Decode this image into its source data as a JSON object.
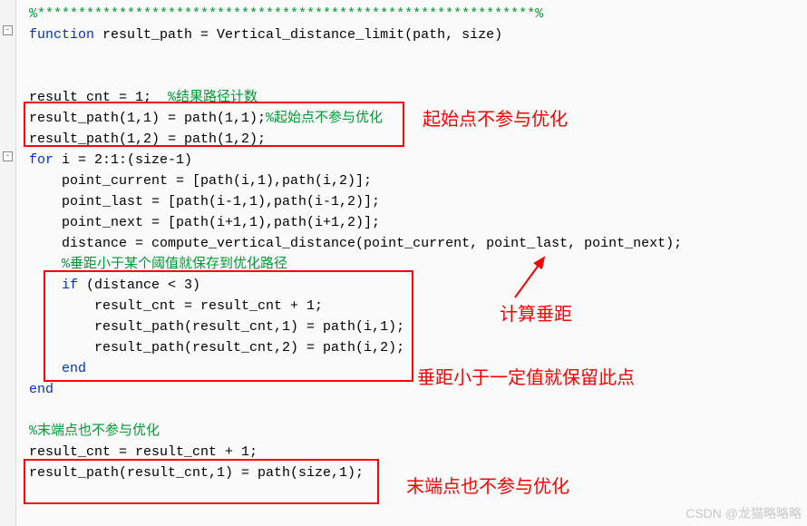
{
  "lines": {
    "l0": "%*************************************************************%",
    "l1_a": "function",
    "l1_b": " result_path = Vertical_distance_limit(path, size)",
    "l2": "",
    "l3": "",
    "l4_a": "result_cnt = 1;  ",
    "l4_b": "%结果路径计数",
    "l5_a": "result_path(1,1) = path(1,1);",
    "l5_b": "%起始点不参与优化",
    "l6": "result_path(1,2) = path(1,2);",
    "l7_a": "for",
    "l7_b": " i = 2:1:(size-1)",
    "l8": "    point_current = [path(i,1),path(i,2)];",
    "l9": "    point_last = [path(i-1,1),path(i-1,2)];",
    "l10": "    point_next = [path(i+1,1),path(i+1,2)];",
    "l11": "    distance = compute_vertical_distance(point_current, point_last, point_next);",
    "l12": "%垂距小于某个阈值就保存到优化路径",
    "l13_a": "    if",
    "l13_b": " (distance < 3)",
    "l14": "        result_cnt = result_cnt + 1;",
    "l15": "        result_path(result_cnt,1) = path(i,1);",
    "l16": "        result_path(result_cnt,2) = path(i,2);",
    "l17": "    end",
    "l18": "end",
    "l19": "",
    "l20": "%末端点也不参与优化",
    "l21": "result_cnt = result_cnt + 1;",
    "l22": "result_path(result_cnt,1) = path(size,1);"
  },
  "annotations": {
    "a1": "起始点不参与优化",
    "a2": "计算垂距",
    "a3": "垂距小于一定值就保留此点",
    "a4": "末端点也不参与优化"
  },
  "watermark": "CSDN @龙猫略略略",
  "fold": "-"
}
